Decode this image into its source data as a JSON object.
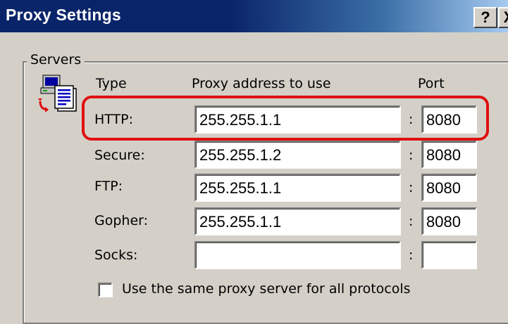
{
  "window": {
    "title": "Proxy Settings",
    "help_label": "?",
    "close_label": "X"
  },
  "servers": {
    "group_label": "Servers",
    "columns": {
      "type": "Type",
      "address": "Proxy address to use",
      "port": "Port"
    },
    "separator": ":",
    "rows": [
      {
        "label": "HTTP:",
        "address": "255.255.1.1",
        "port": "8080",
        "highlighted": true
      },
      {
        "label": "Secure:",
        "address": "255.255.1.2",
        "port": "8080"
      },
      {
        "label": "FTP:",
        "address": "255.255.1.1",
        "port": "8080"
      },
      {
        "label": "Gopher:",
        "address": "255.255.1.1",
        "port": "8080"
      },
      {
        "label": "Socks:",
        "address": "",
        "port": ""
      }
    ]
  },
  "same_proxy": {
    "label": "Use the same proxy server for all protocols",
    "checked": false
  },
  "colors": {
    "highlight": "#e01010",
    "titlebar": "#0a246a",
    "face": "#d4d0c8"
  },
  "icons": {
    "servers": "network-computer-icon"
  }
}
